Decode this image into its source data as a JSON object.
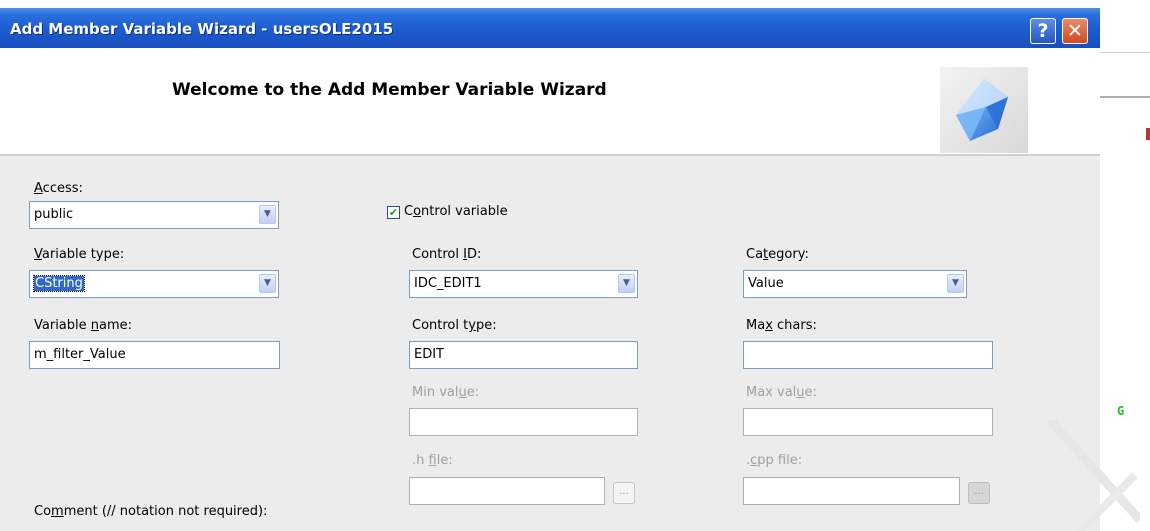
{
  "window": {
    "title": "Add Member Variable Wizard - usersOLE2015",
    "help_glyph": "?",
    "close_glyph": "✕"
  },
  "header": {
    "welcome": "Welcome to the Add Member Variable Wizard"
  },
  "form": {
    "access": {
      "label_u": "A",
      "label_rest": "ccess:",
      "value": "public"
    },
    "control_variable": {
      "checked": true,
      "label_pre": "C",
      "label_u": "o",
      "label_rest": "ntrol variable"
    },
    "variable_type": {
      "label_u": "V",
      "label_rest": "ariable type:",
      "value": "CString"
    },
    "control_id": {
      "label_pre": "Control ",
      "label_u": "I",
      "label_rest": "D:",
      "value": "IDC_EDIT1"
    },
    "category": {
      "label_pre": "Ca",
      "label_u": "t",
      "label_rest": "egory:",
      "value": "Value"
    },
    "variable_name": {
      "label_pre": "Variable ",
      "label_u": "n",
      "label_rest": "ame:",
      "value": "m_filter_Value"
    },
    "control_type": {
      "label_pre": "Control t",
      "label_u": "y",
      "label_rest": "pe:",
      "value": "EDIT"
    },
    "max_chars": {
      "label_pre": "Ma",
      "label_u": "x",
      "label_rest": " chars:",
      "value": ""
    },
    "min_value": {
      "label_pre": "Min val",
      "label_u": "u",
      "label_rest": "e:",
      "value": ""
    },
    "max_value": {
      "label_pre": "Max val",
      "label_u": "u",
      "label_rest": "e:",
      "value": ""
    },
    "h_file": {
      "label_pre": ".h ",
      "label_u": "f",
      "label_rest": "ile:",
      "value": ""
    },
    "cpp_file": {
      "label_pre": ".",
      "label_u": "c",
      "label_rest": "pp file:",
      "value": ""
    },
    "browse_label": "...",
    "comment": {
      "label_pre": "Co",
      "label_u": "m",
      "label_rest": "ment (// notation not required):"
    }
  },
  "side": {
    "g_letter": "G"
  },
  "colors": {
    "titlebar": "#1f5fd3",
    "panel": "#ececec",
    "selection": "#316ac5",
    "check": "#21a121"
  }
}
